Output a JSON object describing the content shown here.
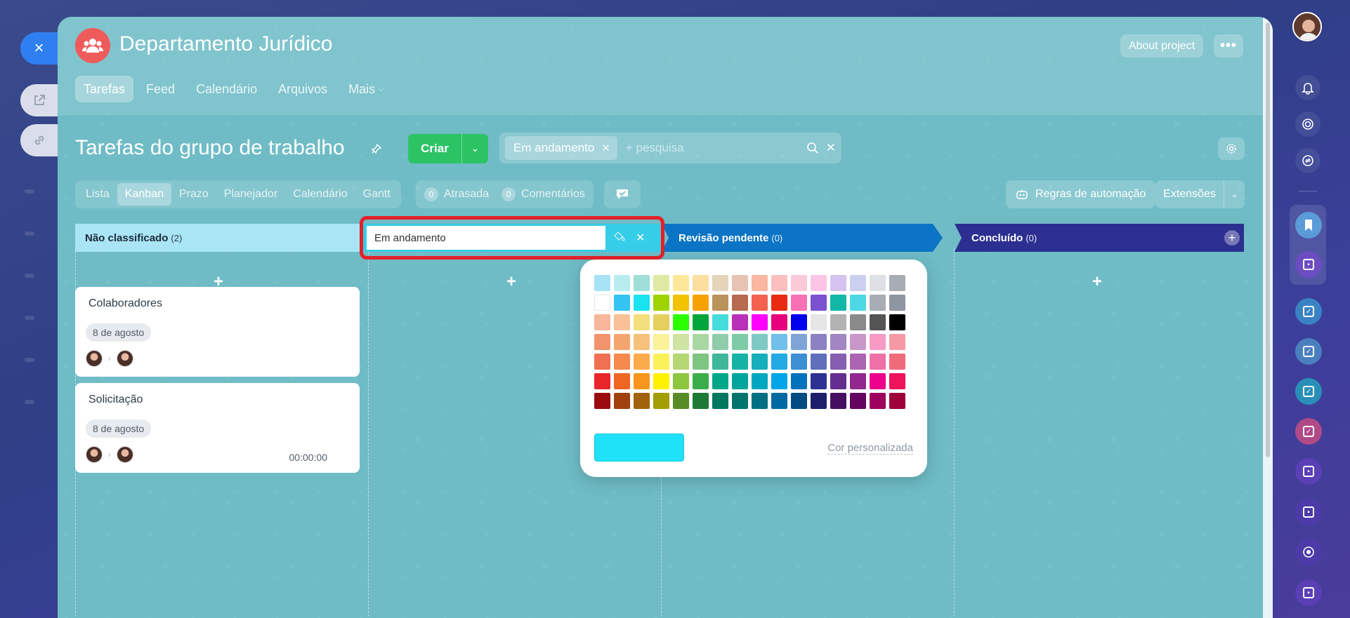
{
  "project": {
    "title": "Departamento Jurídico",
    "about_label": "About project",
    "more_label": "•••"
  },
  "tabs": [
    "Tarefas",
    "Feed",
    "Calendário",
    "Arquivos",
    "Mais"
  ],
  "toolbar": {
    "page_title": "Tarefas do grupo de trabalho",
    "create_label": "Criar",
    "filter_chip": "Em andamento",
    "search_placeholder": "+ pesquisa"
  },
  "views": [
    "Lista",
    "Kanban",
    "Prazo",
    "Planejador",
    "Calendário",
    "Gantt"
  ],
  "counters": [
    {
      "count": "0",
      "label": "Atrasada"
    },
    {
      "count": "0",
      "label": "Comentários"
    }
  ],
  "automation_label": "Regras de automação",
  "extensions_label": "Extensões",
  "columns": [
    {
      "title": "Não classificado",
      "count": "(2)",
      "color": "#a9e5f5"
    },
    {
      "title": "Em andamento",
      "count": "",
      "color": "#36cde8"
    },
    {
      "title": "Revisão pendente",
      "count": "(0)",
      "color": "#0c74c4"
    },
    {
      "title": "Concluído",
      "count": "(0)",
      "color": "#2c2f8f"
    }
  ],
  "cards": [
    {
      "title": "Colaboradores",
      "date": "8 de agosto",
      "timer": ""
    },
    {
      "title": "Solicitação",
      "date": "8 de agosto",
      "timer": "00:00:00"
    }
  ],
  "picker": {
    "custom_label": "Cor personalizada",
    "selected_color": "#1fe1f8",
    "swatches": [
      "#a6e3f6",
      "#b9ecef",
      "#9ee0d8",
      "#dfe9a3",
      "#fbe89a",
      "#fcdf9f",
      "#e4d5b9",
      "#e7c3b3",
      "#f9b7a1",
      "#fbbfbf",
      "#fbc9d8",
      "#fcc5e6",
      "#d4c4ef",
      "#cbd0f0",
      "#dde1e6",
      "#a8adb5",
      "#ffffff",
      "#34c4f3",
      "#1ae3f0",
      "#9ed300",
      "#f2c300",
      "#f6a200",
      "#b9935a",
      "#b86b4e",
      "#f2624e",
      "#ea2b14",
      "#f771b7",
      "#7a52d1",
      "#12b8a6",
      "#4dd8e6",
      "#a8adb5",
      "#8e96a0",
      "#f8b69a",
      "#f9c197",
      "#f3df7c",
      "#e5cf5f",
      "#2cff00",
      "#00a63a",
      "#45dcdc",
      "#b831b8",
      "#ff00ff",
      "#e6007e",
      "#0000ee",
      "#e6e6e6",
      "#b3b3b3",
      "#8a8a8a",
      "#555555",
      "#000000",
      "#f1936c",
      "#f4a56e",
      "#f7c17c",
      "#fbf29b",
      "#cfe3a2",
      "#a9d7a4",
      "#90ccaa",
      "#7dcba7",
      "#7ec9c3",
      "#70c0ea",
      "#7fa5d8",
      "#8b81c3",
      "#a186c1",
      "#c896c9",
      "#f79ac4",
      "#f59aa4",
      "#ef7052",
      "#f5894e",
      "#fbaa4c",
      "#fbf15a",
      "#b5d774",
      "#7ec57f",
      "#3eb79a",
      "#15b3a6",
      "#17aebb",
      "#23a9e4",
      "#3c8fd3",
      "#5f6fbb",
      "#865db0",
      "#ab65b2",
      "#ef6fa7",
      "#ef6b7a",
      "#e8262a",
      "#ee6622",
      "#f7951d",
      "#fff100",
      "#8dc63f",
      "#3aae4a",
      "#00a889",
      "#00a59d",
      "#00a8bf",
      "#00a5e7",
      "#0072bc",
      "#2e3192",
      "#662d91",
      "#92278f",
      "#ec008c",
      "#ed145b",
      "#9b0b0e",
      "#a1410d",
      "#a2620b",
      "#a39e00",
      "#588c26",
      "#1c7a36",
      "#00775f",
      "#00746c",
      "#006f81",
      "#0069a1",
      "#004b82",
      "#1d1f6b",
      "#450e61",
      "#630460",
      "#9e005d",
      "#9e0039"
    ]
  },
  "sidebar": {
    "close_label": "×"
  }
}
